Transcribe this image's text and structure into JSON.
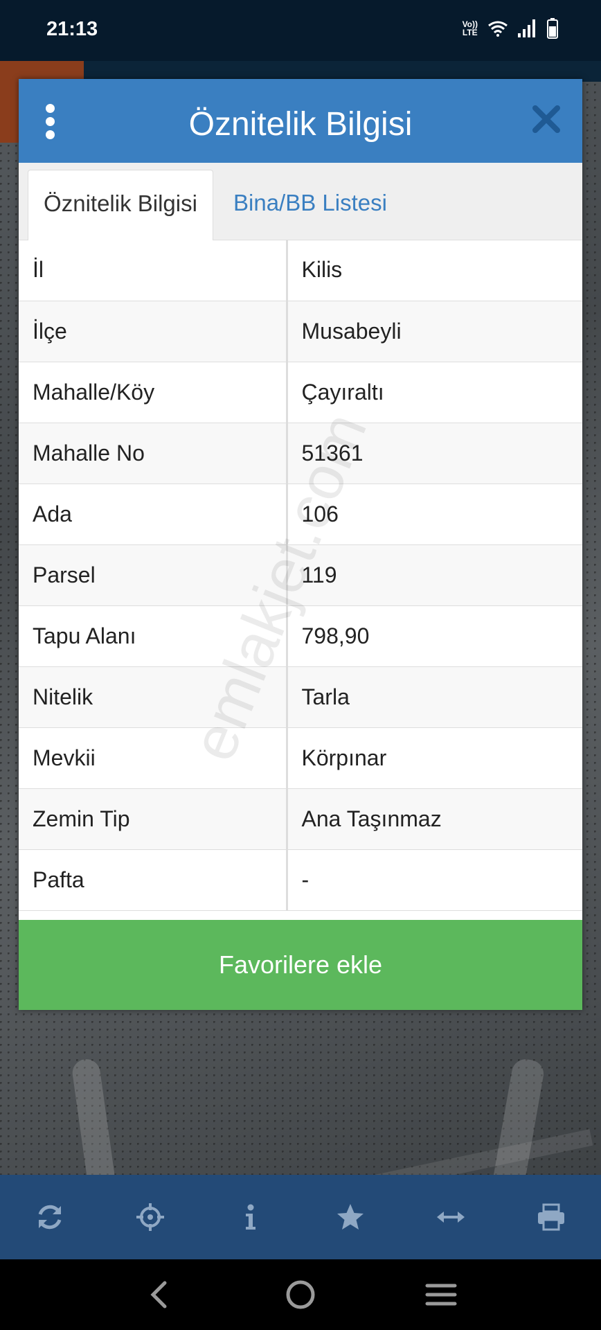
{
  "status_bar": {
    "time": "21:13",
    "network_label": "VoLTE"
  },
  "dialog": {
    "title": "Öznitelik Bilgisi",
    "tabs": [
      {
        "label": "Öznitelik Bilgisi",
        "active": true
      },
      {
        "label": "Bina/BB Listesi",
        "active": false
      }
    ],
    "rows": [
      {
        "key": "İl",
        "value": "Kilis"
      },
      {
        "key": "İlçe",
        "value": "Musabeyli"
      },
      {
        "key": "Mahalle/Köy",
        "value": "Çayıraltı"
      },
      {
        "key": "Mahalle No",
        "value": "51361"
      },
      {
        "key": "Ada",
        "value": "106"
      },
      {
        "key": "Parsel",
        "value": "119"
      },
      {
        "key": "Tapu Alanı",
        "value": "798,90"
      },
      {
        "key": "Nitelik",
        "value": "Tarla"
      },
      {
        "key": "Mevkii",
        "value": "Körpınar"
      },
      {
        "key": "Zemin Tip",
        "value": "Ana Taşınmaz"
      },
      {
        "key": "Pafta",
        "value": "-"
      }
    ],
    "favorite_button": "Favorilere ekle",
    "watermark": "emlakjet.com"
  },
  "toolbar": {
    "items": [
      "refresh-icon",
      "crosshair-icon",
      "info-icon",
      "star-icon",
      "measure-icon",
      "print-icon"
    ]
  },
  "colors": {
    "header_blue": "#3a7fc1",
    "favorite_green": "#5cb85c",
    "toolbar_blue": "#234a77",
    "status_bar": "#061a2c"
  }
}
